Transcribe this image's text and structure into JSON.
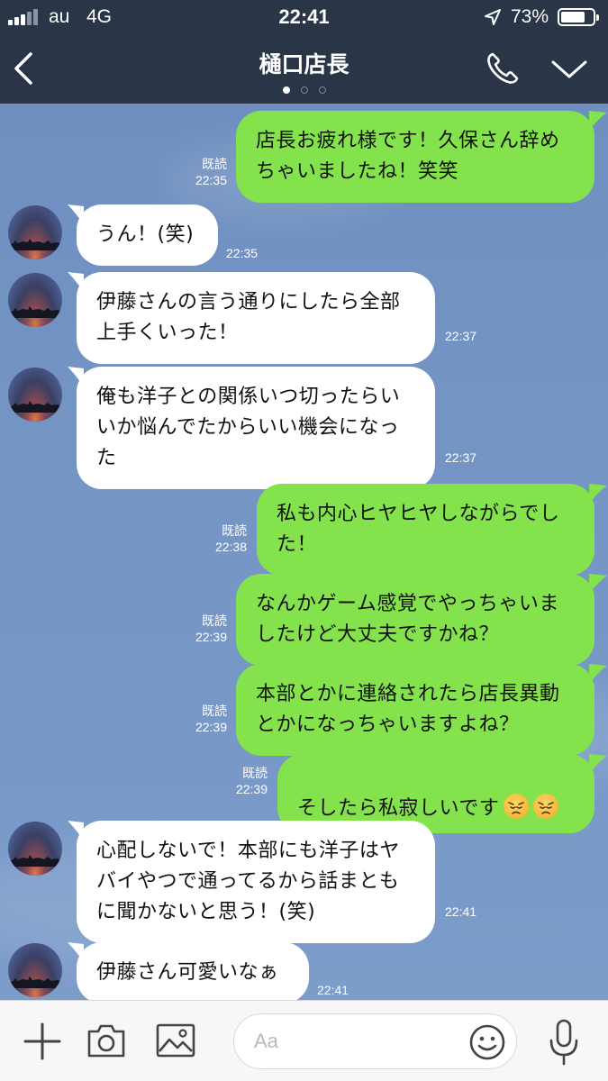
{
  "status_bar": {
    "carrier": "au",
    "network": "4G",
    "time": "22:41",
    "battery_percent": "73%",
    "battery_level": 0.73,
    "signal_bars": 3
  },
  "header": {
    "title": "樋口店長",
    "page_dots": 3,
    "active_dot": 0
  },
  "messages": [
    {
      "dir": "out",
      "text": "店長お疲れ様です！久保さん辞め\nちゃいましたね！笑笑",
      "read": "既読",
      "time": "22:35"
    },
    {
      "dir": "in",
      "text": "うん！(笑)",
      "time": "22:35"
    },
    {
      "dir": "in",
      "text": "伊藤さんの言う通りにしたら全部\n上手くいった！",
      "time": "22:37"
    },
    {
      "dir": "in",
      "text": "俺も洋子との関係いつ切ったらい\nいか悩んでたからいい機会になっ\nた",
      "time": "22:37"
    },
    {
      "dir": "out",
      "text": "私も内心ヒヤヒヤしながらでし\nた！",
      "read": "既読",
      "time": "22:38"
    },
    {
      "dir": "out",
      "text": "なんかゲーム感覚でやっちゃいま\nしたけど大丈夫ですかね？",
      "read": "既読",
      "time": "22:39"
    },
    {
      "dir": "out",
      "text": "本部とかに連絡されたら店長異動\nとかになっちゃいますよね？",
      "read": "既読",
      "time": "22:39"
    },
    {
      "dir": "out",
      "text": "そしたら私寂しいです",
      "emoji": [
        "disappointed-face",
        "disappointed-face"
      ],
      "read": "既読",
      "time": "22:39"
    },
    {
      "dir": "in",
      "text": "心配しないで！本部にも洋子はヤ\nバイやつで通ってるから話まとも\nに聞かないと思う！(笑)",
      "time": "22:41"
    },
    {
      "dir": "in",
      "text": "伊藤さん可愛いなぁ",
      "time": "22:41"
    }
  ],
  "input_bar": {
    "placeholder": "Aa",
    "icons": [
      "plus-icon",
      "camera-icon",
      "image-icon",
      "emoji-icon",
      "microphone-icon"
    ]
  },
  "colors": {
    "header_bg": "#2b3548",
    "outgoing_bubble": "#84e34c",
    "incoming_bubble": "#ffffff",
    "chat_bg": "#7494c4"
  }
}
